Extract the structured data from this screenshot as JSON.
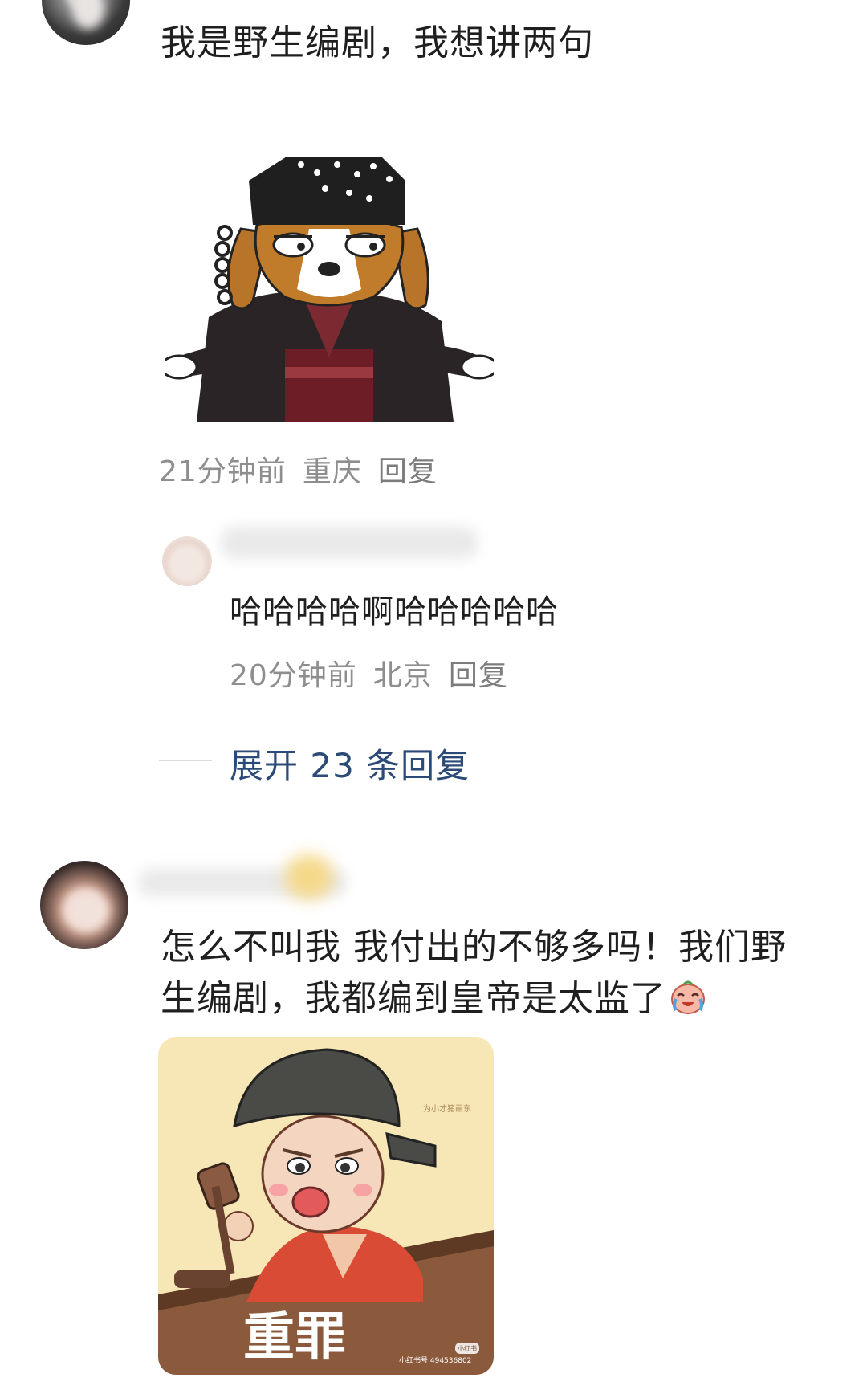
{
  "comments": [
    {
      "text": "我是野生编剧，我想讲两句",
      "time": "21分钟前",
      "location": "重庆",
      "reply_label": "回复",
      "sticker_icon": "judge-dog-sticker-icon"
    },
    {
      "text_line1": "怎么不叫我 我付出的不够多吗！我们野",
      "text_line2": "生编剧，我都编到皇帝是太监了",
      "emoji_icon": "laughing-crying-emoji-icon",
      "sticker": {
        "caption": "重罪",
        "watermark_top": "为小才猪画东",
        "watermark_bottom": "小红书号 494536802",
        "watermark_badge": "小红书"
      }
    }
  ],
  "reply": {
    "text": "哈哈哈哈啊哈哈哈哈哈",
    "time": "20分钟前",
    "location": "北京",
    "reply_label": "回复"
  },
  "expand": {
    "label": "展开 23 条回复"
  },
  "colors": {
    "link_blue": "#2b4a77",
    "meta_gray": "#8e8e8e",
    "sticker_bg": "#f7e6b6"
  }
}
